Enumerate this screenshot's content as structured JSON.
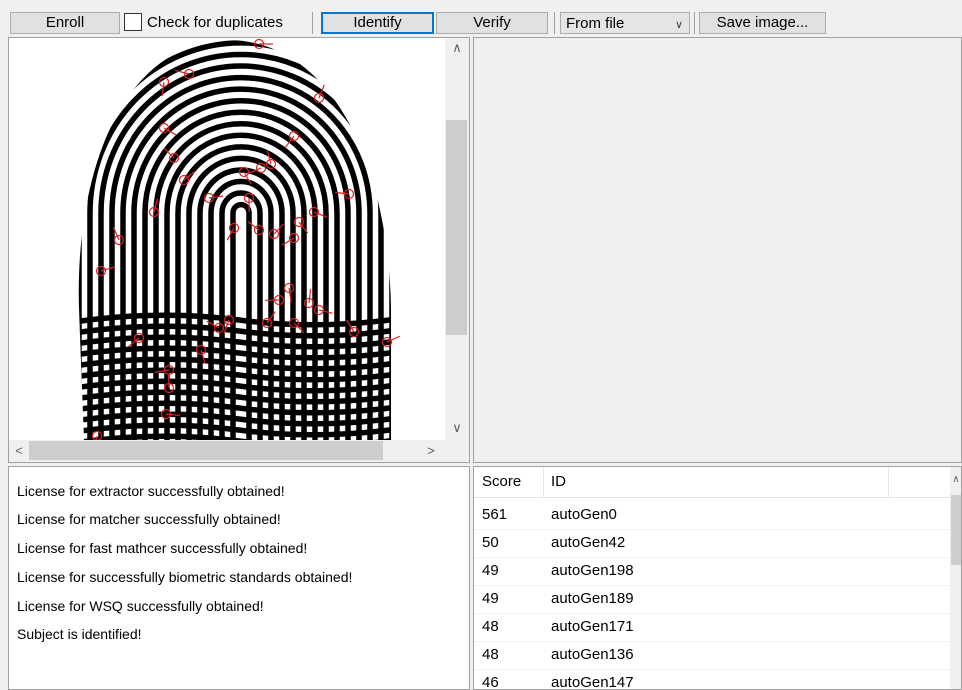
{
  "toolbar": {
    "enroll_label": "Enroll",
    "check_duplicates_label": "Check for duplicates",
    "check_duplicates_checked": false,
    "identify_label": "Identify",
    "verify_label": "Verify",
    "source_select_value": "From file",
    "save_image_label": "Save image..."
  },
  "log": {
    "lines": [
      "License for extractor successfully obtained!",
      "License for matcher successfully obtained!",
      "License for fast mathcer successfully obtained!",
      "License for successfully biometric standards obtained!",
      "License for WSQ successfully obtained!",
      "Subject is identified!"
    ]
  },
  "results": {
    "columns": [
      "Score",
      "ID"
    ],
    "rows": [
      {
        "score": "561",
        "id": "autoGen0"
      },
      {
        "score": "50",
        "id": "autoGen42"
      },
      {
        "score": "49",
        "id": "autoGen198"
      },
      {
        "score": "49",
        "id": "autoGen189"
      },
      {
        "score": "48",
        "id": "autoGen171"
      },
      {
        "score": "48",
        "id": "autoGen136"
      },
      {
        "score": "46",
        "id": "autoGen147"
      }
    ]
  },
  "colors": {
    "minutiae": "#e02020",
    "focus_border": "#0078d7",
    "window_bg": "#f0f0f0"
  }
}
